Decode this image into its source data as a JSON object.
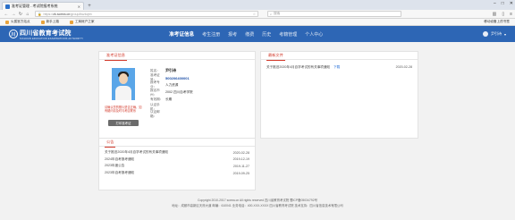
{
  "browser": {
    "tab_title": "准考证管理 - 考试院报考系统",
    "url_prefix": "https://",
    "url_host": "zk.sceea.cn",
    "url_path": "/group/kszkqhh",
    "search_placeholder": "搜索",
    "bookmarks": [
      "火狐官方站点",
      "新手上路",
      "工商帐户之家"
    ],
    "bookmark_right": "移动设备上的书签"
  },
  "site": {
    "logo_text": "四川省教育考试院",
    "logo_en": "SICHUAN EDUCATION EXAMINATIONS AUTHORITY",
    "nav": [
      "准考证信息",
      "考生注册",
      "报考",
      "缴费",
      "历史",
      "考籍管理",
      "个人中心"
    ],
    "user": "尹引诗"
  },
  "info_panel": {
    "title": "准考证信息",
    "fields": [
      {
        "label": "姓名：",
        "value": "尹引诗",
        "style": "bold"
      },
      {
        "label": "准考证号：",
        "value": "500206400001",
        "style": "blue"
      },
      {
        "label": "报考专业：",
        "value": "人力资源",
        "style": ""
      },
      {
        "label": "报名市州：",
        "value": "2002 四川自考学院",
        "style": ""
      },
      {
        "label": "有效期：",
        "value": "长期",
        "style": ""
      },
      {
        "label": "认证手机：",
        "value": "",
        "style": ""
      },
      {
        "label": "认证邮箱：",
        "value": "",
        "style": ""
      }
    ],
    "warning": "请确认您的照片是否正确，如有疑问请及时与考区联系",
    "print_button": "打印准考证"
  },
  "notice_panel": {
    "title": "最新文件",
    "items": [
      {
        "text": "关于推迟2020年4月自学考试的有关事项通知",
        "link": "下载",
        "date": "2020-02-28"
      }
    ]
  },
  "public_panel": {
    "title": "公告",
    "items": [
      {
        "text": "关于推迟2020年4月自学考试的有关事项通知",
        "date": "2020-02-28"
      },
      {
        "text": "2024年自考报考通知",
        "date": "2019-12-19"
      },
      {
        "text": "2023年度公告",
        "date": "2019-11-27"
      },
      {
        "text": "2023年自考报考通知",
        "date": "2019-09-25"
      }
    ]
  },
  "footer": {
    "line1": "Copyright 2010-2017 sceea.cn All rights reserved  四川省教育考试院 蜀ICP备05034792号",
    "line2": "地址：成都市高新区天府大道 邮编：610041 业务电话：400-XXX-XXXX 四川省教育考试院 技术支持：四川省信息技术有限公司"
  }
}
